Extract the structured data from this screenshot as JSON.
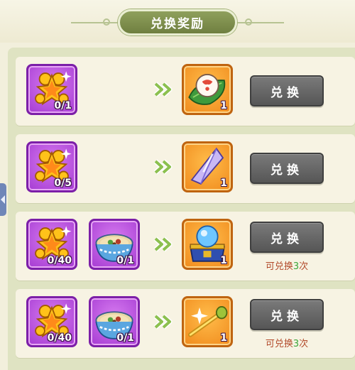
{
  "title": "兑换奖励",
  "colors": {
    "slot_purple": "#a53bd2",
    "slot_orange": "#f08a1c",
    "button_gray": "#606060",
    "title_green": "#7b8c48",
    "arrow_green": "#8cc04f"
  },
  "rows": [
    {
      "costs": [
        {
          "icon": "golden-star-charm-icon",
          "count": "0/1"
        }
      ],
      "reward": {
        "icon": "steamed-bun-on-leaf-icon",
        "count": "1"
      },
      "button": "兑换",
      "limit": null
    },
    {
      "costs": [
        {
          "icon": "golden-star-charm-icon",
          "count": "0/5"
        }
      ],
      "reward": {
        "icon": "purple-crystal-icon",
        "count": "1"
      },
      "button": "兑换",
      "limit": null
    },
    {
      "costs": [
        {
          "icon": "golden-star-charm-icon",
          "count": "0/40"
        },
        {
          "icon": "noodle-bowl-icon",
          "count": "0/1"
        }
      ],
      "reward": {
        "icon": "crystal-ball-chest-icon",
        "count": "1"
      },
      "button": "兑换",
      "limit": {
        "prefix": "可兑换",
        "count": "3",
        "suffix": "次"
      }
    },
    {
      "costs": [
        {
          "icon": "golden-star-charm-icon",
          "count": "0/40"
        },
        {
          "icon": "noodle-bowl-icon",
          "count": "0/1"
        }
      ],
      "reward": {
        "icon": "golden-staff-icon",
        "count": "1"
      },
      "button": "兑换",
      "limit": {
        "prefix": "可兑换",
        "count": "3",
        "suffix": "次"
      }
    }
  ]
}
